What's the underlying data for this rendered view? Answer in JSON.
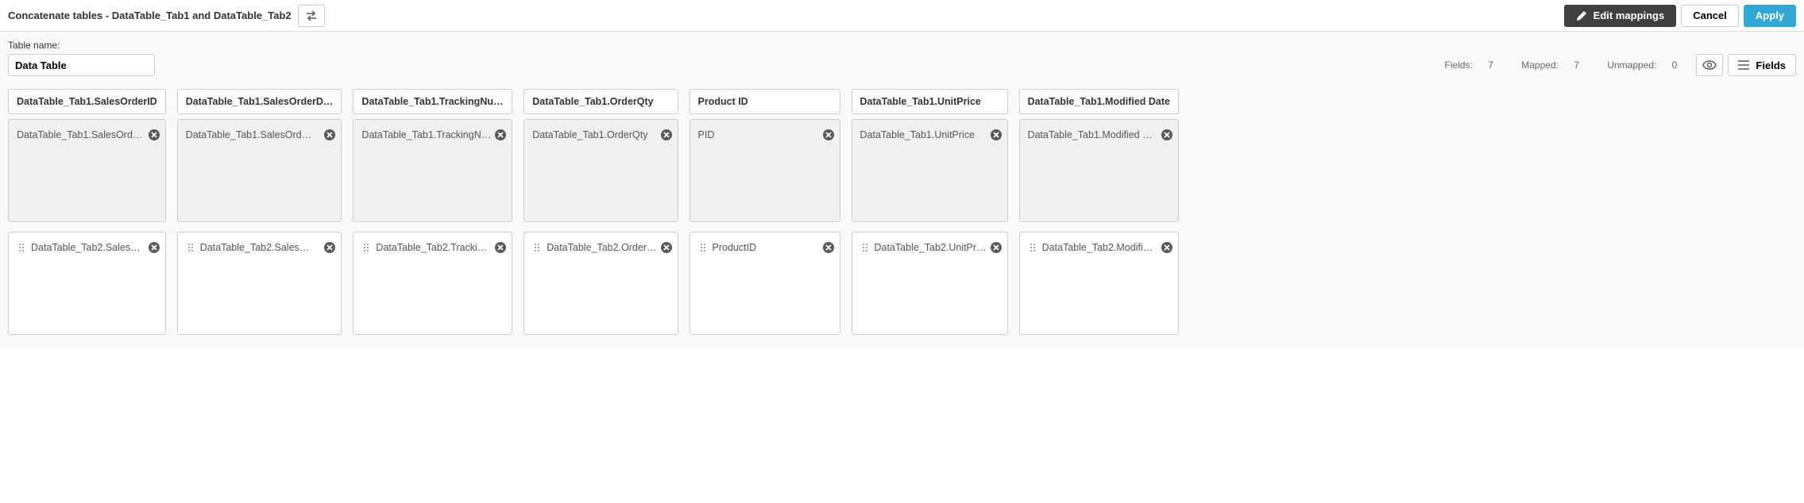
{
  "header": {
    "title": "Concatenate tables - DataTable_Tab1 and DataTable_Tab2",
    "edit_mappings": "Edit mappings",
    "cancel": "Cancel",
    "apply": "Apply"
  },
  "tablename": {
    "label": "Table name:",
    "value": "Data Table"
  },
  "stats": {
    "fields_label": "Fields:",
    "fields_value": "7",
    "mapped_label": "Mapped:",
    "mapped_value": "7",
    "unmapped_label": "Unmapped:",
    "unmapped_value": "0",
    "fields_button": "Fields"
  },
  "columns": [
    {
      "header": "DataTable_Tab1.SalesOrderID",
      "top": "DataTable_Tab1.SalesOrd…",
      "bottom": "DataTable_Tab2.Sales…"
    },
    {
      "header": "DataTable_Tab1.SalesOrderD…",
      "top": "DataTable_Tab1.SalesOrd…",
      "bottom": "DataTable_Tab2.Sales…"
    },
    {
      "header": "DataTable_Tab1.TrackingNu…",
      "top": "DataTable_Tab1.TrackingN…",
      "bottom": "DataTable_Tab2.Tracki…"
    },
    {
      "header": "DataTable_Tab1.OrderQty",
      "top": "DataTable_Tab1.OrderQty",
      "bottom": "DataTable_Tab2.Order…"
    },
    {
      "header": "Product ID",
      "top": "PID",
      "bottom": "ProductID"
    },
    {
      "header": "DataTable_Tab1.UnitPrice",
      "top": "DataTable_Tab1.UnitPrice",
      "bottom": "DataTable_Tab2.UnitPr…"
    },
    {
      "header": "DataTable_Tab1.Modified Date",
      "top": "DataTable_Tab1.Modified …",
      "bottom": "DataTable_Tab2.Modifi…"
    }
  ]
}
